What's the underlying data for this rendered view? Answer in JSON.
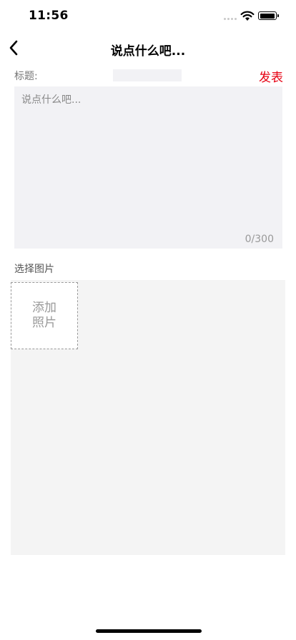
{
  "status_bar": {
    "time": "11:56"
  },
  "nav": {
    "title": "说点什么吧..."
  },
  "form": {
    "title_label": "标题:",
    "title_value": "",
    "publish_label": "发表",
    "content_placeholder": "说点什么吧...",
    "content_value": "",
    "char_counter": "0/300",
    "choose_image_label": "选择图片",
    "add_photo_label": "添加照片"
  },
  "colors": {
    "accent": "#e60012",
    "input_bg": "#f2f2f5",
    "image_area_bg": "#f4f4f4"
  },
  "icons": {
    "back": "chevron-left-icon",
    "signal": "signal-icon",
    "wifi": "wifi-icon",
    "battery": "battery-icon"
  }
}
